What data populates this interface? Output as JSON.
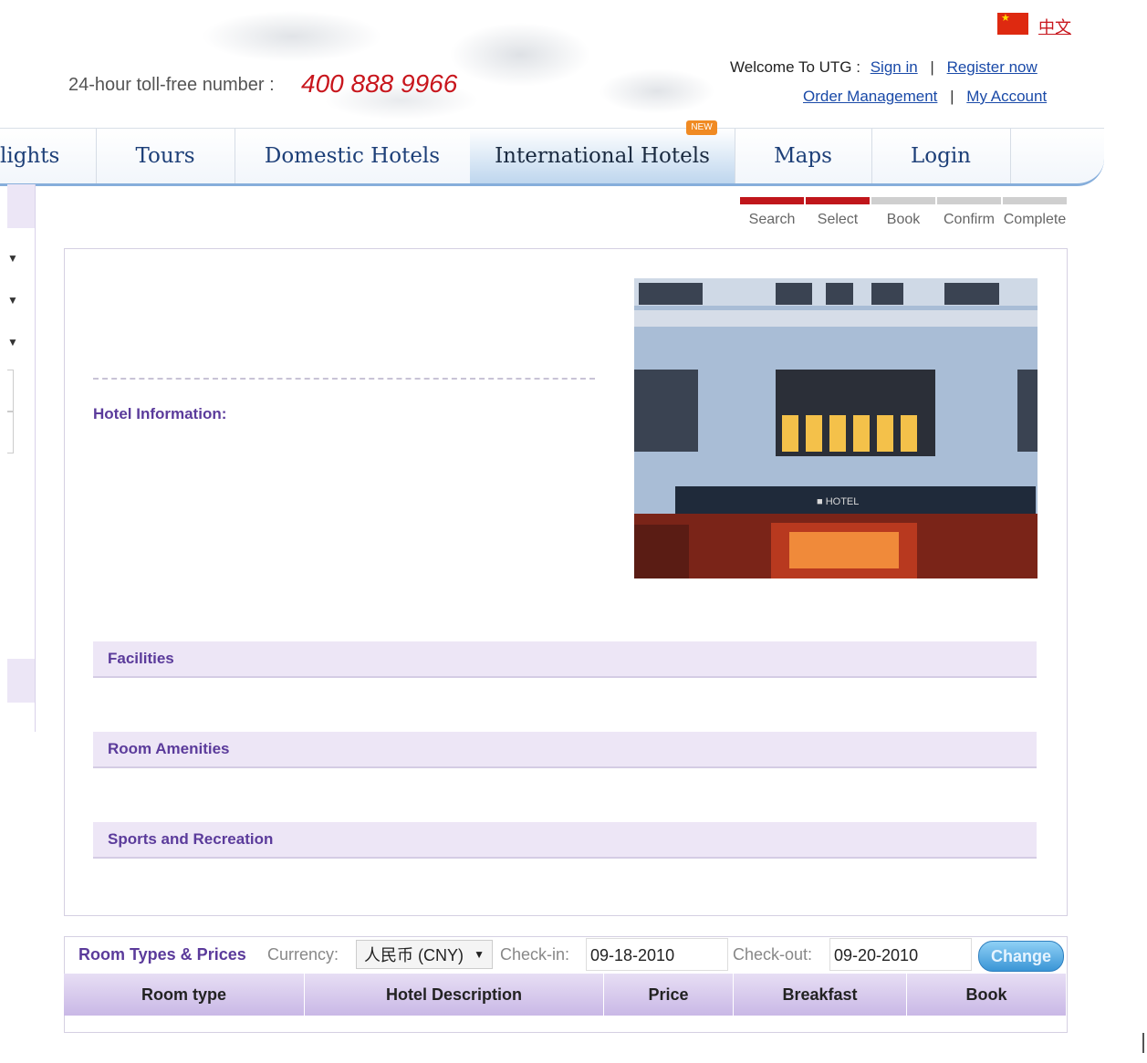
{
  "header": {
    "tollfree_label": "24-hour toll-free number :",
    "tollfree_number": "400 888 9966",
    "language_link": "中文",
    "welcome_text": "Welcome To UTG :",
    "sign_in": "Sign in",
    "register": "Register now",
    "order_management": "Order Management",
    "my_account": "My Account",
    "separator": "|"
  },
  "nav": {
    "items": [
      {
        "label": "lights"
      },
      {
        "label": "Tours"
      },
      {
        "label": "Domestic Hotels"
      },
      {
        "label": "International Hotels"
      },
      {
        "label": "Maps"
      },
      {
        "label": "Login"
      }
    ],
    "active_index": 3,
    "new_badge": "NEW"
  },
  "progress": {
    "steps": [
      "Search",
      "Select",
      "Book",
      "Confirm",
      "Complete"
    ],
    "completed": 2,
    "active_color": "#c0161b",
    "inactive_color": "#cfcfcf"
  },
  "hotel": {
    "info_label": "Hotel Information:",
    "sections": [
      "Facilities",
      "Room Amenities",
      "Sports and Recreation"
    ],
    "photo_sign": "■ HOTEL"
  },
  "room_types": {
    "title": "Room Types & Prices",
    "currency_label": "Currency:",
    "currency_value": "人民币 (CNY)",
    "checkin_label": "Check-in:",
    "checkin_value": "09-18-2010",
    "checkout_label": "Check-out:",
    "checkout_value": "09-20-2010",
    "change_button": "Change",
    "columns": [
      "Room type",
      "Hotel Description",
      "Price",
      "Breakfast",
      "Book"
    ]
  },
  "colors": {
    "accent_purple": "#5b3b9b",
    "brand_red": "#c8161d",
    "link_blue": "#1a4aa8",
    "nav_border": "#86aedb"
  }
}
